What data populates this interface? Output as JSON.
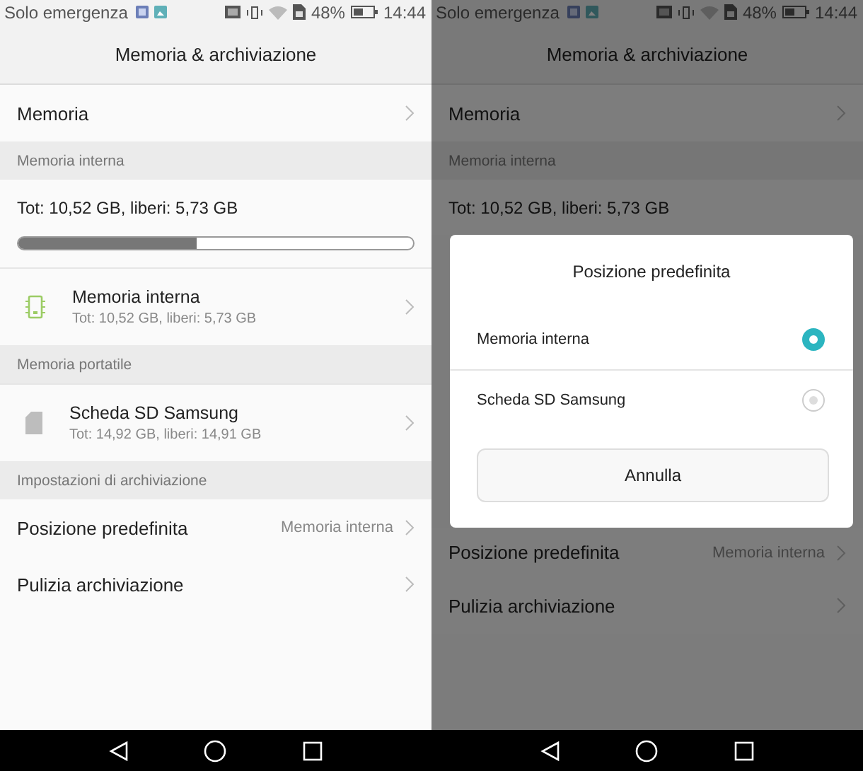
{
  "screens": [
    {
      "dimmed": false,
      "status_bar": {
        "carrier": "Solo emergenza",
        "battery_percent": "48%",
        "time": "14:44"
      },
      "title": "Memoria & archiviazione",
      "items": [
        {
          "kind": "row",
          "label": "Memoria"
        },
        {
          "kind": "header",
          "label": "Memoria interna"
        },
        {
          "kind": "storage",
          "text": "Tot: 10,52 GB, liberi: 5,73 GB",
          "level": 0.45
        },
        {
          "kind": "chip",
          "label": "Memoria interna",
          "detail": "Tot: 10,52 GB, liberi: 5,73 GB"
        },
        {
          "kind": "header",
          "label": "Memoria portatile"
        },
        {
          "kind": "card",
          "label": "Scheda SD Samsung",
          "detail": "Tot: 14,92 GB, liberi: 14,91 GB"
        },
        {
          "kind": "header",
          "label": "Impostazioni di archiviazione"
        },
        {
          "kind": "row",
          "label": "Posizione predefinita",
          "value": "Memoria interna"
        },
        {
          "kind": "row",
          "label": "Pulizia archiviazione"
        }
      ]
    },
    {
      "dimmed": true,
      "status_bar": {
        "carrier": "Solo emergenza",
        "battery_percent": "48%",
        "time": "14:44"
      },
      "title": "Memoria & archiviazione",
      "items": [
        {
          "kind": "row",
          "label": "Memoria"
        },
        {
          "kind": "header",
          "label": "Memoria interna"
        },
        {
          "kind": "storage",
          "text": "Tot: 10,52 GB, liberi: 5,73 GB"
        },
        {
          "kind": "dialog",
          "title": "Posizione predefinita",
          "options": [
            {
              "label": "Memoria interna",
              "selected": true
            },
            {
              "label": "Scheda SD Samsung",
              "selected": false
            }
          ],
          "cancel": "Annulla"
        },
        {
          "kind": "row",
          "label": "Posizione predefinita",
          "value": "Memoria interna"
        },
        {
          "kind": "row",
          "label": "Pulizia archiviazione"
        }
      ]
    }
  ]
}
